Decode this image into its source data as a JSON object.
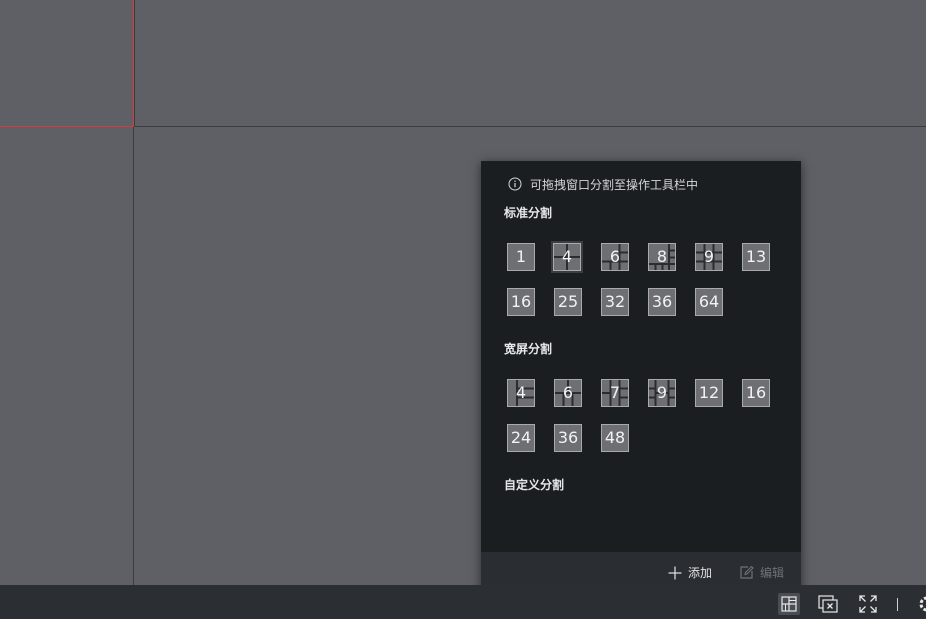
{
  "panes": [
    {
      "id": "pane-1",
      "selected": true
    },
    {
      "id": "pane-2",
      "selected": false
    },
    {
      "id": "pane-3",
      "selected": false
    },
    {
      "id": "pane-4",
      "selected": false
    }
  ],
  "popup": {
    "hint": "可拖拽窗口分割至操作工具栏中",
    "standard_title": "标准分割",
    "standard_layouts": [
      "1",
      "4",
      "6",
      "8",
      "9",
      "13",
      "16",
      "25",
      "32",
      "36",
      "64"
    ],
    "standard_selected": "4",
    "widescreen_title": "宽屏分割",
    "widescreen_layouts": [
      "4",
      "6",
      "7",
      "9",
      "12",
      "16",
      "24",
      "36",
      "48"
    ],
    "custom_title": "自定义分割",
    "add_label": "添加",
    "edit_label": "编辑"
  },
  "colors": {
    "background": "#5e6066",
    "popup_bg": "#1b1e21",
    "selected_pane_border": "#d9393f"
  }
}
